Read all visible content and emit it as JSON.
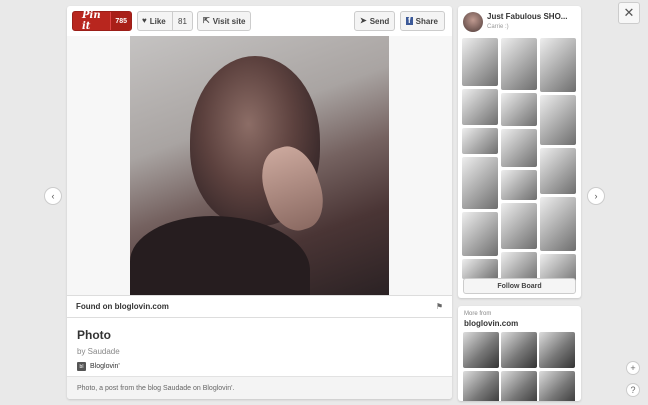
{
  "pin": {
    "pinit_label": "Pin it",
    "pinit_count": "785",
    "like_label": "Like",
    "like_count": "81",
    "visit_label": "Visit site",
    "send_label": "Send",
    "share_label": "Share",
    "found_on": "Found on bloglovin.com",
    "title": "Photo",
    "by_line": "by Saudade",
    "source_name": "Bloglovin'",
    "source_badge": "bl",
    "caption": "Photo, a post from the blog Saudade on Bloglovin'."
  },
  "board": {
    "title": "Just Fabulous SHO...",
    "owner": "Carrie :)",
    "follow_label": "Follow Board"
  },
  "more": {
    "label": "More from",
    "source": "bloglovin.com"
  },
  "nav": {
    "prev_glyph": "‹",
    "next_glyph": "›",
    "close_glyph": "✕",
    "add_glyph": "+",
    "help_glyph": "?"
  },
  "colors": {
    "pinit_red": "#b8261e",
    "background": "#e9e9e9"
  },
  "icons": {
    "heart": "heart-icon",
    "visit": "link-icon",
    "send": "send-icon",
    "share": "facebook-icon",
    "flag": "flag-icon"
  }
}
